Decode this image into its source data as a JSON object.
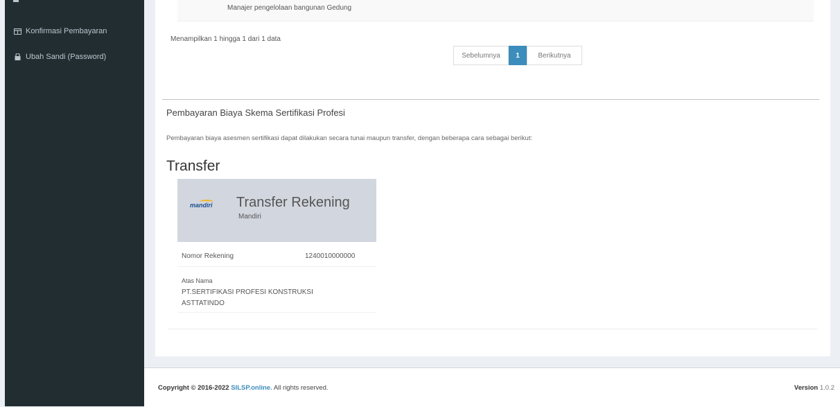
{
  "sidebar": {
    "items": [
      {
        "label": "Konfirmasi Pembayaran",
        "icon": "credit-card-icon"
      },
      {
        "label": "Ubah Sandi (Password)",
        "icon": "lock-icon"
      }
    ]
  },
  "table": {
    "previous_row_text": "Manajer pengelolaan bangunan Gedung",
    "info": "Menampilkan 1 hingga 1 dari 1 data",
    "pagination": {
      "prev": "Sebelumnya",
      "current": "1",
      "next": "Berikutnya"
    }
  },
  "payment": {
    "title": "Pembayaran Biaya Skema Sertifikasi Profesi",
    "description": "Pembayaran biaya asesmen sertifikasi dapat dilakukan secara tunai maupun transfer, dengan beberapa cara sebagai berikut:",
    "transfer_heading": "Transfer",
    "card": {
      "logo_text": "mandiri",
      "title": "Transfer Rekening",
      "bank": "Mandiri",
      "account_label": "Nomor Rekening",
      "account_number": "1240010000000",
      "name_label": "Atas Nama",
      "name_line1": "PT.SERTIFIKASI PROFESI KONSTRUKSI",
      "name_line2": "ASTTATINDO"
    }
  },
  "footer": {
    "copyright_prefix": "Copyright © 2016-2022",
    "brand": "SILSP.online.",
    "suffix": "All rights reserved.",
    "version_label": "Version",
    "version_value": "1.0.2"
  },
  "colors": {
    "sidebar_bg": "#222d32",
    "accent": "#3c8dbc",
    "page_bg": "#ecf0f5"
  }
}
